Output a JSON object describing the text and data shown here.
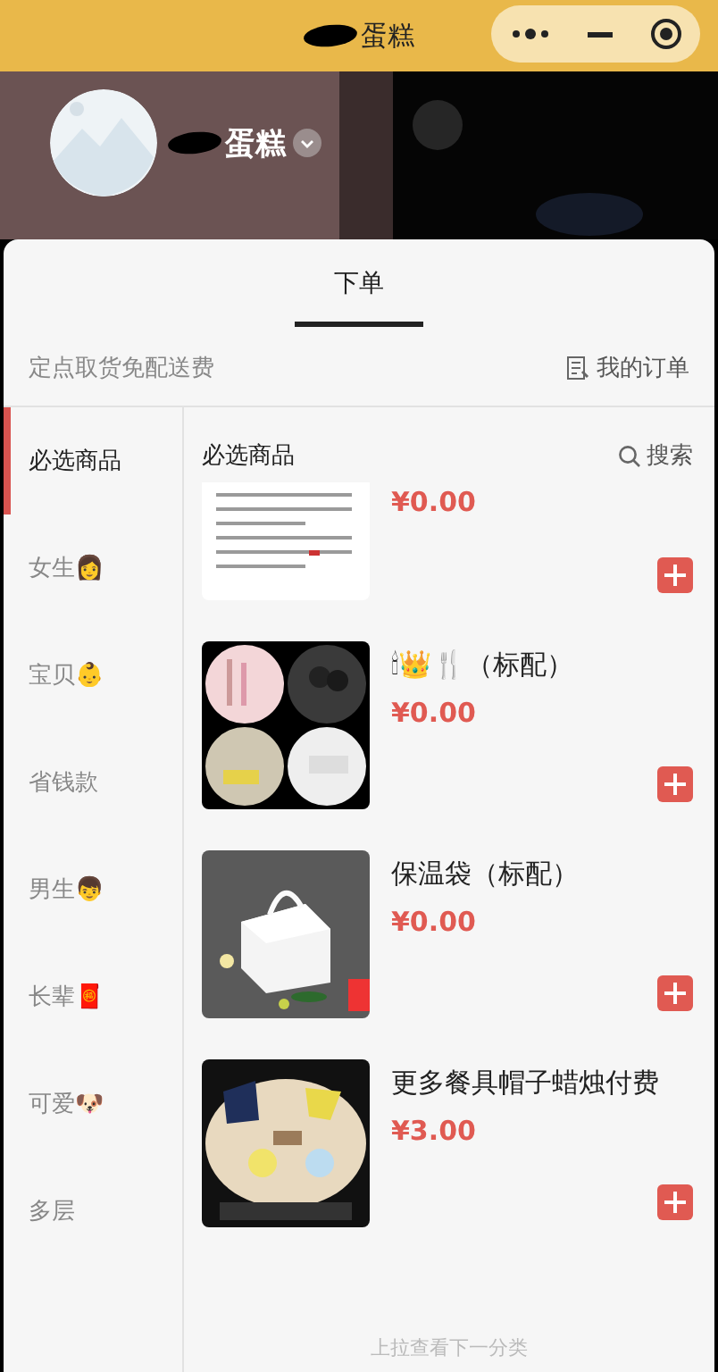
{
  "nav_bar": {
    "title": "蛋糕"
  },
  "shop": {
    "name": "蛋糕"
  },
  "tabs": [
    {
      "label": "下单",
      "selected": true
    }
  ],
  "notice": "定点取货免配送费",
  "orders_link": "我的订单",
  "categories": [
    {
      "label": "必选商品",
      "selected": true
    },
    {
      "label": "女生👩",
      "selected": false
    },
    {
      "label": "宝贝👶",
      "selected": false
    },
    {
      "label": "省钱款",
      "selected": false
    },
    {
      "label": "男生👦",
      "selected": false
    },
    {
      "label": "长辈🧧",
      "selected": false
    },
    {
      "label": "可爱🐶",
      "selected": false
    },
    {
      "label": "多层",
      "selected": false
    }
  ],
  "section": {
    "title": "必选商品",
    "search": "搜索"
  },
  "products": [
    {
      "kind": "partial",
      "price": "¥0.00"
    },
    {
      "kind": "full",
      "title": "🕯👑🍴（标配）",
      "price": "¥0.00"
    },
    {
      "kind": "full",
      "title": "保温袋（标配）",
      "price": "¥0.00"
    },
    {
      "kind": "full",
      "title": "更多餐具帽子蜡烛付费",
      "price": "¥3.00"
    }
  ],
  "footer_hint": "上拉查看下一分类"
}
